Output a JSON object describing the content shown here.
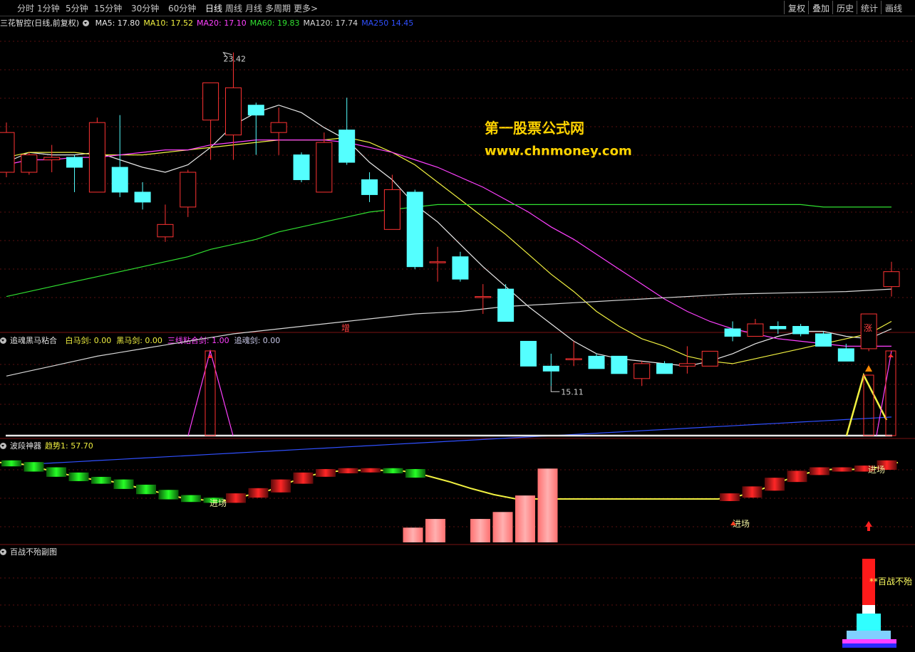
{
  "toolbar": {
    "periods": [
      "分时",
      "1分钟",
      "5分钟",
      "15分钟",
      "30分钟",
      "60分钟",
      "日线",
      "周线",
      "月线",
      "多周期",
      "更多>"
    ],
    "active_period": "日线",
    "right_buttons": [
      "复权",
      "叠加",
      "历史",
      "统计",
      "画线"
    ]
  },
  "main_panel": {
    "title": "三花智控(日线,前复权)",
    "ma_labels": [
      {
        "name": "MA5",
        "text": "MA5: 17.80",
        "color": "#e8e8e8"
      },
      {
        "name": "MA10",
        "text": "MA10: 17.52",
        "color": "#f0f040"
      },
      {
        "name": "MA20",
        "text": "MA20: 17.10",
        "color": "#ff40ff"
      },
      {
        "name": "MA60",
        "text": "MA60: 19.83",
        "color": "#30e030"
      },
      {
        "name": "MA120",
        "text": "MA120: 17.74",
        "color": "#d8d8d8"
      },
      {
        "name": "MA250",
        "text": "MA250  14.45",
        "color": "#3050ff"
      }
    ],
    "high_label": "23.42",
    "low_label": "15.11",
    "marker_zeng": "增",
    "marker_zhang": "涨",
    "watermark_line1": "第一股票公式网",
    "watermark_line2": "www.chnmoney.com"
  },
  "panel2": {
    "title": "追魂黑马粘合",
    "labels": [
      {
        "text": "白马剑: 0.00",
        "color": "#f0f040"
      },
      {
        "text": "黑马剑: 0.00",
        "color": "#f0f040"
      },
      {
        "text": "三线粘合剑: 1.00",
        "color": "#ff40ff"
      },
      {
        "text": "追魂剑: 0.00",
        "color": "#c8c8e8"
      }
    ]
  },
  "panel3": {
    "title": "波段神器",
    "trend_label": "趋势1: 57.70",
    "entry_label": "进场"
  },
  "panel4": {
    "title": "百战不殆副图",
    "annotation": "百战不殆"
  },
  "chart_data": {
    "type": "candlestick",
    "title": "三花智控(日线,前复权)",
    "price_range": [
      12.5,
      24.5
    ],
    "grid": true,
    "candles": [
      {
        "o": 18.6,
        "c": 20.2,
        "h": 20.6,
        "l": 18.4
      },
      {
        "o": 18.6,
        "c": 19.3,
        "h": 19.4,
        "l": 18.5
      },
      {
        "o": 19.1,
        "c": 19.2,
        "h": 19.7,
        "l": 18.6
      },
      {
        "o": 19.2,
        "c": 18.8,
        "h": 19.3,
        "l": 17.8
      },
      {
        "o": 17.8,
        "c": 20.6,
        "h": 20.8,
        "l": 17.8
      },
      {
        "o": 18.8,
        "c": 17.8,
        "h": 20.9,
        "l": 17.6
      },
      {
        "o": 17.8,
        "c": 17.4,
        "h": 18.2,
        "l": 17.1
      },
      {
        "o": 16.0,
        "c": 16.5,
        "h": 17.3,
        "l": 15.8
      },
      {
        "o": 17.2,
        "c": 18.6,
        "h": 18.7,
        "l": 16.8
      },
      {
        "o": 20.7,
        "c": 22.2,
        "h": 22.2,
        "l": 19.1
      },
      {
        "o": 20.1,
        "c": 22.0,
        "h": 23.42,
        "l": 19.1
      },
      {
        "o": 21.3,
        "c": 20.9,
        "h": 21.4,
        "l": 19.3
      },
      {
        "o": 20.2,
        "c": 20.6,
        "h": 21.2,
        "l": 19.3
      },
      {
        "o": 19.3,
        "c": 18.3,
        "h": 19.4,
        "l": 18.2
      },
      {
        "o": 17.8,
        "c": 19.8,
        "h": 20.2,
        "l": 17.8
      },
      {
        "o": 20.3,
        "c": 19.0,
        "h": 21.6,
        "l": 18.9
      },
      {
        "o": 18.3,
        "c": 17.7,
        "h": 18.6,
        "l": 17.4
      },
      {
        "o": 16.3,
        "c": 17.9,
        "h": 18.5,
        "l": 16.3
      },
      {
        "o": 17.8,
        "c": 14.8,
        "h": 17.9,
        "l": 14.7
      },
      {
        "o": 15.0,
        "c": 15.0,
        "h": 15.6,
        "l": 14.2
      },
      {
        "o": 15.2,
        "c": 14.3,
        "h": 15.4,
        "l": 14.2
      },
      {
        "o": 13.6,
        "c": 13.6,
        "h": 14.1,
        "l": 12.9
      },
      {
        "o": 13.9,
        "c": 12.6,
        "h": 14.1,
        "l": 12.6
      },
      {
        "o": 11.8,
        "c": 10.8,
        "h": 11.8,
        "l": 10.8
      },
      {
        "o": 10.8,
        "c": 10.6,
        "h": 11.3,
        "l": 10.0
      },
      {
        "o": 11.1,
        "c": 11.1,
        "h": 11.8,
        "l": 10.8
      },
      {
        "o": 11.2,
        "c": 10.7,
        "h": 11.3,
        "l": 10.7
      },
      {
        "o": 11.2,
        "c": 10.5,
        "h": 11.2,
        "l": 10.5
      },
      {
        "o": 10.3,
        "c": 10.9,
        "h": 11.0,
        "l": 10.0
      },
      {
        "o": 10.9,
        "c": 10.5,
        "h": 11.0,
        "l": 10.5
      },
      {
        "o": 10.8,
        "c": 10.9,
        "h": 11.6,
        "l": 10.5
      },
      {
        "o": 10.8,
        "c": 11.4,
        "h": 11.4,
        "l": 10.8
      },
      {
        "o": 12.3,
        "c": 12.0,
        "h": 12.6,
        "l": 11.8
      },
      {
        "o": 12.0,
        "c": 12.5,
        "h": 12.7,
        "l": 12.0
      },
      {
        "o": 12.4,
        "c": 12.3,
        "h": 12.6,
        "l": 12.1
      },
      {
        "o": 12.4,
        "c": 12.1,
        "h": 12.5,
        "l": 12.0
      },
      {
        "o": 12.1,
        "c": 11.6,
        "h": 12.2,
        "l": 11.6
      },
      {
        "o": 11.5,
        "c": 11.0,
        "h": 11.7,
        "l": 11.0
      },
      {
        "o": 11.5,
        "c": 12.9,
        "h": 12.9,
        "l": 11.4
      },
      {
        "o": 14.0,
        "c": 14.6,
        "h": 15.0,
        "l": 13.6
      }
    ],
    "ma_series": [
      {
        "name": "MA5",
        "color": "#e8e8e8",
        "values": [
          19.0,
          19.4,
          19.3,
          19.3,
          19.4,
          19.1,
          18.8,
          18.6,
          18.9,
          19.6,
          20.5,
          21.0,
          21.3,
          21.0,
          20.4,
          19.9,
          19.0,
          18.3,
          17.3,
          16.6,
          15.7,
          14.8,
          14.0,
          13.2,
          12.5,
          11.8,
          11.3,
          11.1,
          11.0,
          10.9,
          10.8,
          11.0,
          11.3,
          11.7,
          12.0,
          12.2,
          12.2,
          12.0,
          11.9,
          12.3
        ]
      },
      {
        "name": "MA10",
        "color": "#f0f040",
        "values": [
          19.2,
          19.4,
          19.4,
          19.4,
          19.3,
          19.3,
          19.3,
          19.4,
          19.5,
          19.6,
          19.7,
          19.8,
          19.9,
          19.9,
          19.9,
          20.0,
          19.8,
          19.4,
          18.9,
          18.2,
          17.5,
          16.8,
          16.1,
          15.3,
          14.5,
          13.8,
          13.0,
          12.4,
          11.9,
          11.6,
          11.2,
          11.0,
          10.9,
          11.1,
          11.3,
          11.5,
          11.7,
          11.9,
          12.1,
          12.6
        ]
      },
      {
        "name": "MA20",
        "color": "#ff40ff",
        "values": [
          18.9,
          19.1,
          19.1,
          19.2,
          19.2,
          19.3,
          19.4,
          19.5,
          19.5,
          19.7,
          19.8,
          19.9,
          19.9,
          19.9,
          19.9,
          19.8,
          19.6,
          19.4,
          19.1,
          18.8,
          18.4,
          18.0,
          17.5,
          17.0,
          16.4,
          15.9,
          15.3,
          14.7,
          14.1,
          13.5,
          13.0,
          12.6,
          12.3,
          12.1,
          11.9,
          11.8,
          11.7,
          11.6,
          11.6,
          11.6
        ]
      },
      {
        "name": "MA60",
        "color": "#30e030",
        "values": [
          13.6,
          13.8,
          14.0,
          14.2,
          14.4,
          14.6,
          14.8,
          15.0,
          15.2,
          15.5,
          15.7,
          15.9,
          16.2,
          16.4,
          16.6,
          16.8,
          17.0,
          17.1,
          17.2,
          17.3,
          17.3,
          17.3,
          17.3,
          17.3,
          17.3,
          17.3,
          17.3,
          17.3,
          17.3,
          17.3,
          17.3,
          17.3,
          17.3,
          17.3,
          17.3,
          17.3,
          17.2,
          17.2,
          17.2,
          17.2
        ]
      },
      {
        "name": "MA120",
        "color": "#d8d8d8",
        "values": [
          10.4,
          10.6,
          10.8,
          11.0,
          11.2,
          11.35,
          11.5,
          11.65,
          11.8,
          11.95,
          12.1,
          12.2,
          12.3,
          12.4,
          12.5,
          12.6,
          12.7,
          12.8,
          12.9,
          12.95,
          13.0,
          13.1,
          13.2,
          13.25,
          13.3,
          13.35,
          13.4,
          13.45,
          13.5,
          13.55,
          13.6,
          13.65,
          13.7,
          13.72,
          13.74,
          13.76,
          13.78,
          13.8,
          13.85,
          13.9
        ]
      },
      {
        "name": "MA250",
        "color": "#3050ff",
        "values": [
          6.8,
          6.85,
          6.9,
          6.95,
          7.0,
          7.05,
          7.1,
          7.15,
          7.2,
          7.25,
          7.3,
          7.35,
          7.4,
          7.45,
          7.5,
          7.55,
          7.6,
          7.65,
          7.7,
          7.75,
          7.8,
          7.85,
          7.9,
          7.95,
          8.0,
          8.05,
          8.1,
          8.15,
          8.2,
          8.25,
          8.3,
          8.35,
          8.4,
          8.45,
          8.5,
          8.55,
          8.6,
          8.65,
          8.7,
          8.75
        ]
      }
    ],
    "indicator_lines": {
      "trend": [
        92,
        90,
        84,
        78,
        73,
        70,
        64,
        58,
        52,
        49,
        48,
        54,
        60,
        70,
        78,
        82,
        83,
        83,
        82,
        77,
        70,
        62,
        55,
        50,
        50,
        50,
        50,
        50,
        50,
        50,
        50,
        50,
        50,
        54,
        62,
        72,
        80,
        84,
        84,
        86,
        92
      ]
    },
    "panel3_bars": {
      "indexes": [
        18,
        19,
        21,
        22,
        23,
        24
      ],
      "values": [
        17,
        27,
        27,
        35,
        54,
        85
      ],
      "range": [
        0,
        100
      ]
    }
  }
}
